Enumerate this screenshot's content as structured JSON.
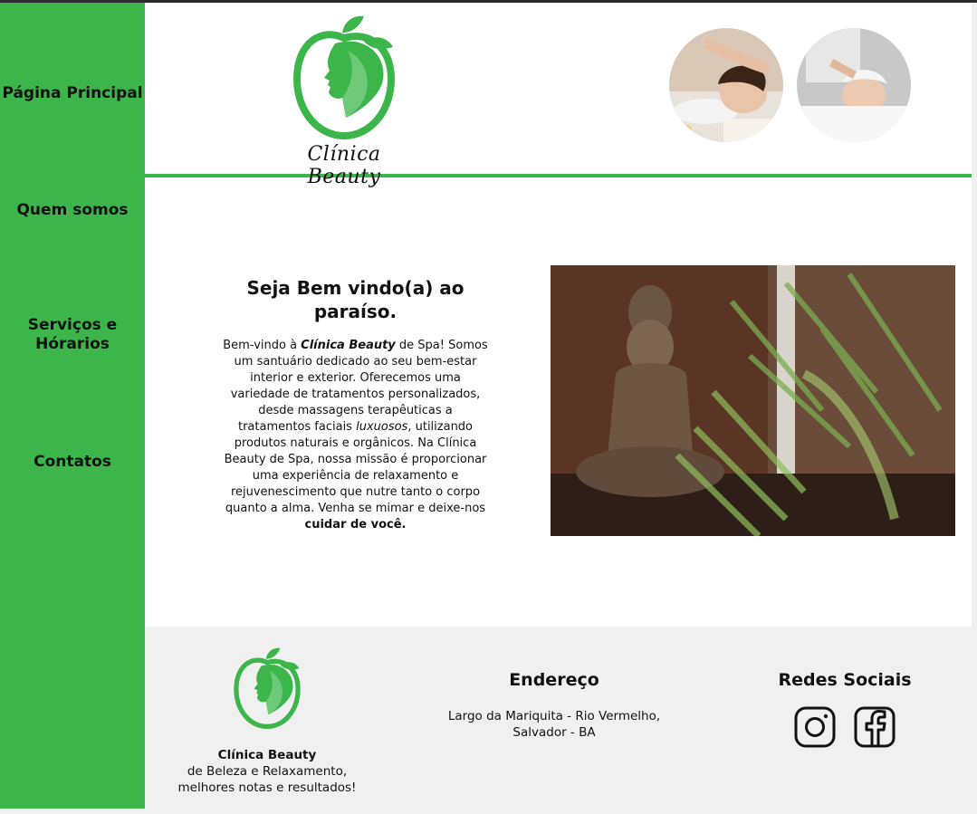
{
  "nav": {
    "home": "Página Principal",
    "about": "Quem somos",
    "services": "Serviços e Hórarios",
    "contacts": "Contatos"
  },
  "header": {
    "brand": "Clínica Beauty"
  },
  "main": {
    "title": "Seja Bem vindo(a) ao paraíso.",
    "p_intro": "Bem-vindo à ",
    "p_brand": "Clínica Beauty",
    "p_1": " de Spa! Somos um santuário dedicado ao seu bem-estar interior e exterior. Oferecemos uma variedade de tratamentos personalizados, desde massagens terapêuticas a tratamentos faciais ",
    "p_lux": "luxuosos",
    "p_2": ", utilizando produtos naturais e orgânicos. Na Clínica Beauty de Spa, nossa missão é proporcionar uma experiência de relaxamento e rejuvenescimento que nutre tanto o corpo quanto a alma. Venha se mimar e deixe-nos ",
    "p_end": "cuidar de você."
  },
  "footer": {
    "brand_name": "Clínica Beauty",
    "brand_line1": "de Beleza e Relaxamento,",
    "brand_line2": "melhores notas e resultados!",
    "address_title": "Endereço",
    "address_line1": "Largo da Mariquita - Rio Vermelho,",
    "address_line2": "Salvador - BA",
    "social_title": "Redes Sociais"
  },
  "colors": {
    "accent": "#3cb54a",
    "footer_bg": "#f0f0f0"
  },
  "icons": {
    "logo": "apple-leaf-face-logo",
    "instagram": "instagram-icon",
    "facebook": "facebook-icon"
  }
}
